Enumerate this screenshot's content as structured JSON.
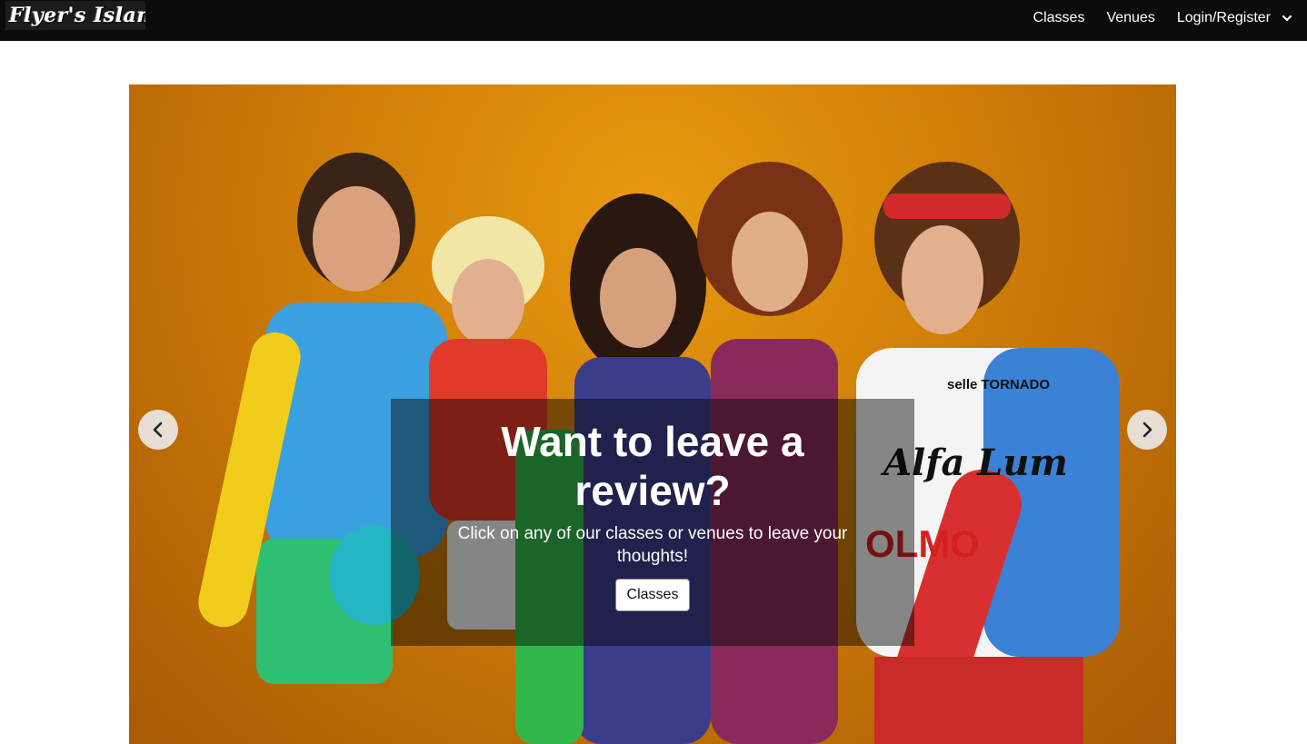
{
  "navbar": {
    "logo_text": "Flyer's Island",
    "links": [
      "Classes",
      "Venues"
    ],
    "account_label": "Login/Register"
  },
  "hero": {
    "title": "Want to leave a review?",
    "text": "Click on any of our classes or venues to leave your thoughts!",
    "button_label": "Classes",
    "photo_text_1": "selle TORNADO",
    "photo_text_2": "Alfa Lum",
    "photo_text_3": "OLMO"
  },
  "colors": {
    "navbar_bg": "#0b0b0b",
    "hero_bg": "#d98708"
  }
}
